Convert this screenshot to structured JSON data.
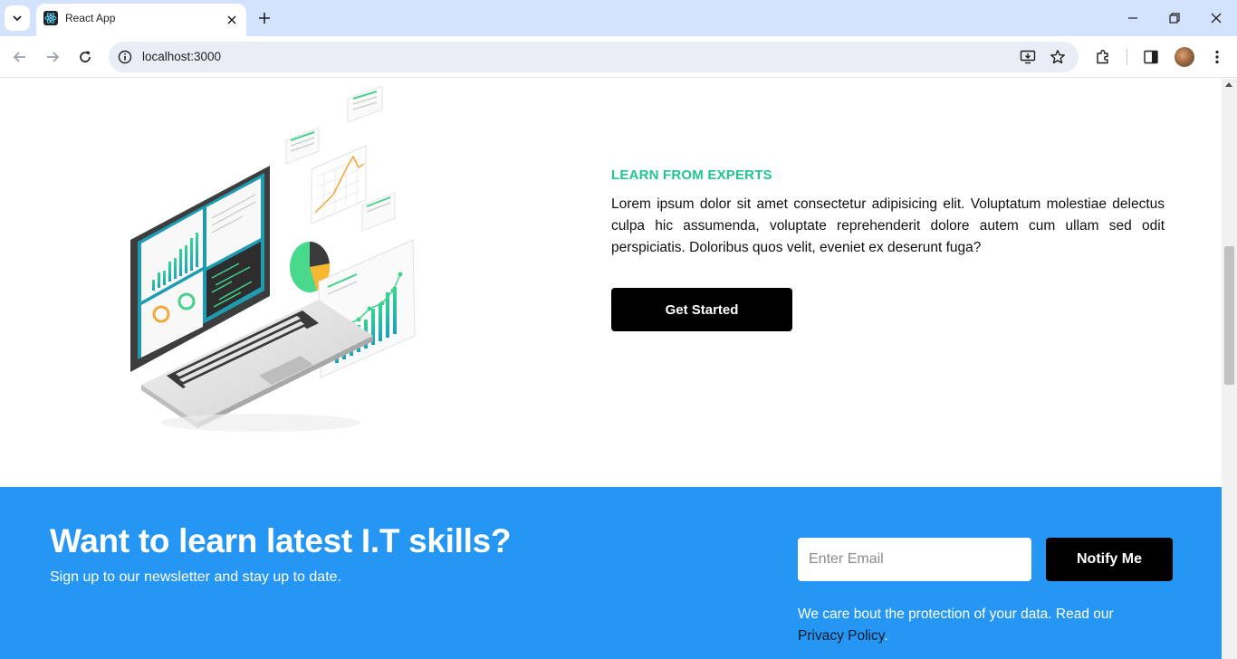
{
  "browser": {
    "tab_title": "React App",
    "url": "localhost:3000",
    "icons": {
      "tab_list": "chevron-down-icon",
      "favicon": "react-logo-icon",
      "tab_close": "close-icon",
      "new_tab": "plus-icon",
      "minimize": "minimize-icon",
      "restore": "restore-icon",
      "close_window": "close-icon",
      "back": "arrow-left-icon",
      "forward": "arrow-right-icon",
      "reload": "reload-icon",
      "site_info": "info-icon",
      "install": "install-app-icon",
      "bookmark": "star-icon",
      "extensions": "puzzle-icon",
      "side_panel": "side-panel-icon",
      "profile": "avatar",
      "menu": "kebab-menu-icon"
    }
  },
  "hero": {
    "eyebrow": "LEARN FROM EXPERTS",
    "text": "Lorem ipsum dolor sit amet consectetur adipisicing elit. Voluptatum molestiae delectus culpa hic assumenda, voluptate reprehenderit dolore autem cum ullam sed odit perspiciatis. Doloribus quos velit, eveniet ex deserunt fuga?",
    "cta_label": "Get Started",
    "illustration": "laptop-analytics-illustration"
  },
  "newsletter": {
    "heading": "Want to learn latest I.T skills?",
    "subheading": "Sign up to our newsletter and stay up to date.",
    "email_placeholder": "Enter Email",
    "email_value": "",
    "button_label": "Notify Me",
    "privacy_text": "We care bout the protection of your data. Read our ",
    "privacy_link": "Privacy Policy",
    "privacy_end": "."
  },
  "colors": {
    "tabbar_bg": "#d3e3fd",
    "accent_green": "#23c48e",
    "newsletter_bg": "#2596f3",
    "button_bg": "#000000"
  }
}
